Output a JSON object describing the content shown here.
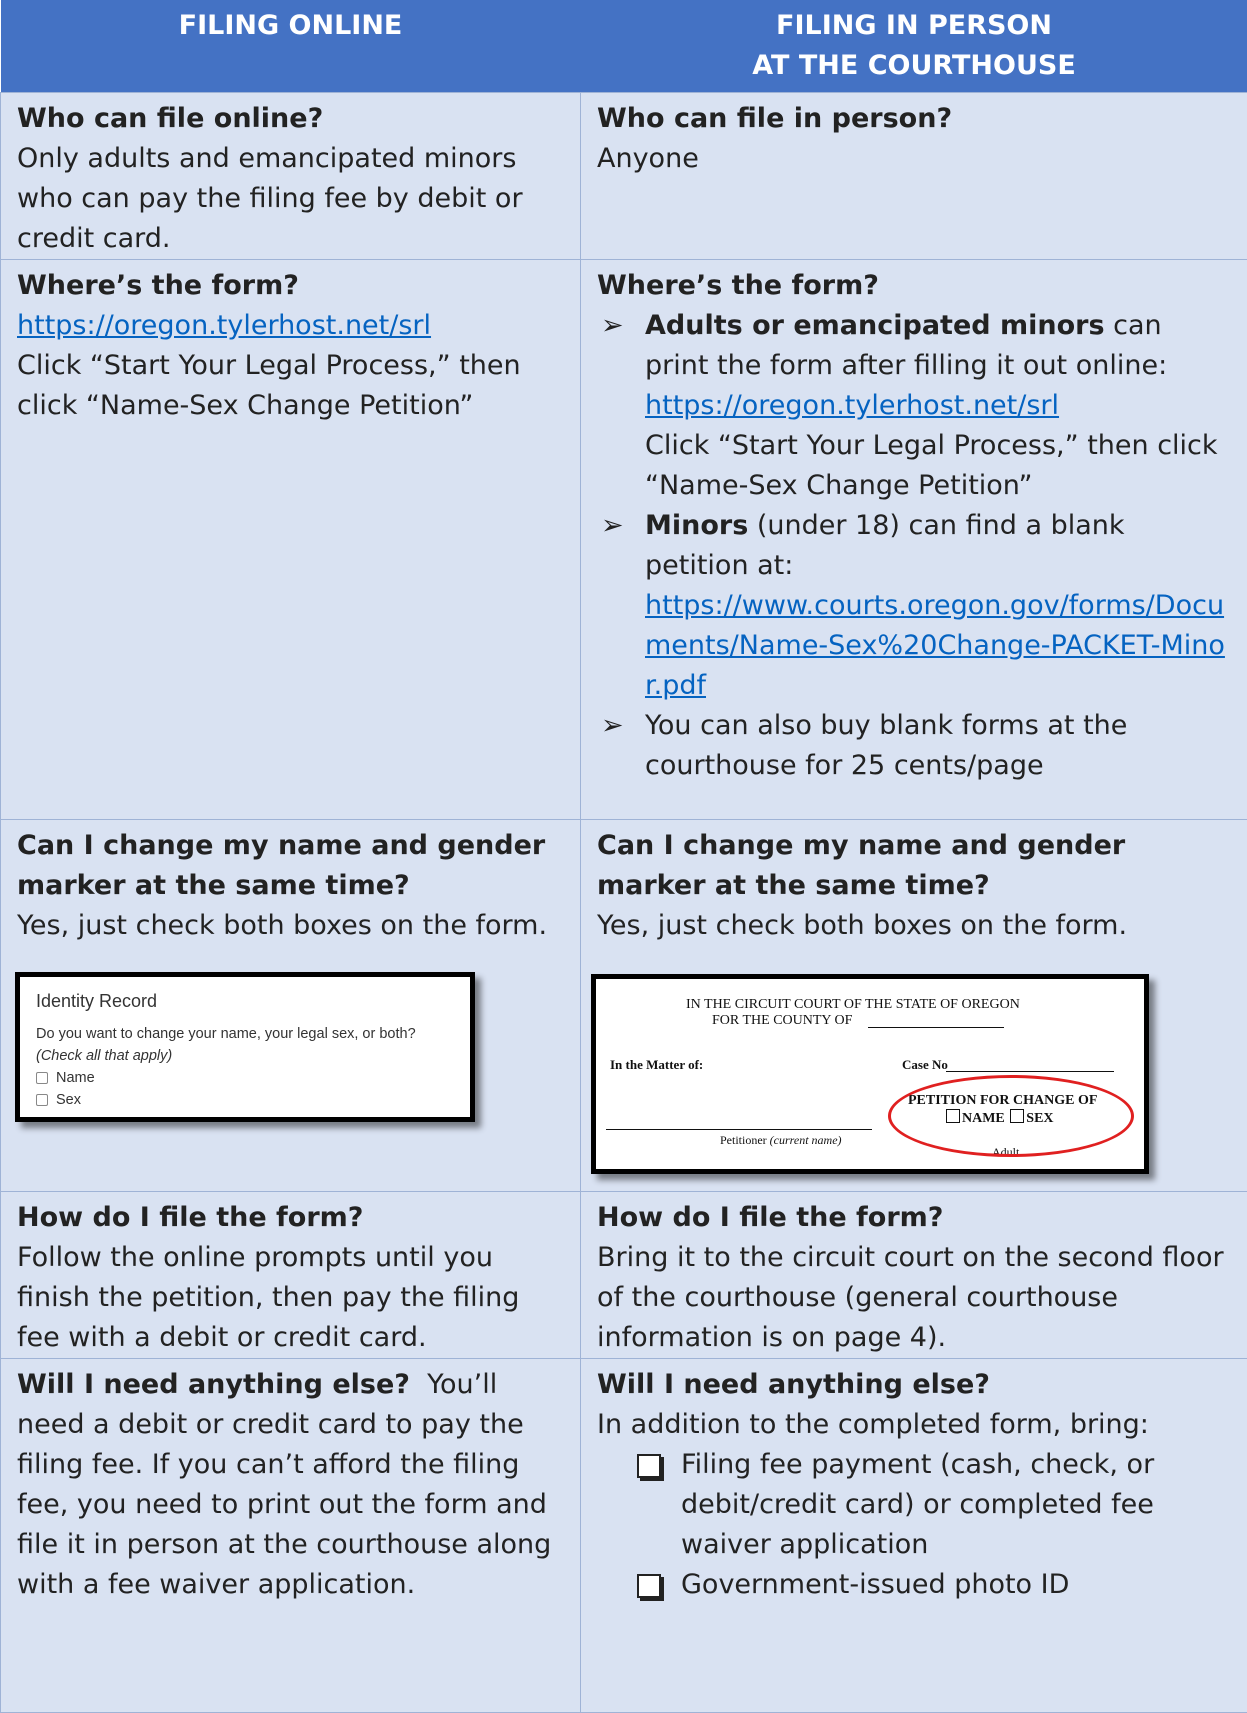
{
  "header": {
    "col_left": "FILING ONLINE",
    "col_right_line1": "FILING IN PERSON",
    "col_right_line2": "AT THE COURTHOUSE"
  },
  "row_who": {
    "left_q": "Who can file online?",
    "left_a": "Only adults and emancipated minors who can pay the filing fee by debit or credit card.",
    "right_q": "Who can file in person?",
    "right_a": "Anyone"
  },
  "row_form": {
    "left_q": "Where’s the form?",
    "left_link": "https://oregon.tylerhost.net/srl",
    "left_text": "Click “Start Your Legal Process,” then click “Name-Sex Change Petition”",
    "right_q": "Where’s the form?",
    "right_items": [
      {
        "bold": "Adults or emancipated minors",
        "text": " can print the form after filling it out online:",
        "link": "https://oregon.tylerhost.net/srl",
        "after": "Click “Start Your Legal Process,” then click “Name-Sex Change Petition”"
      },
      {
        "bold": "Minors",
        "text": " (under 18) can find a blank petition at:",
        "link": "https://www.courts.oregon.gov/forms/Documents/Name-Sex%20Change-PACKET-Minor.pdf",
        "after": ""
      },
      {
        "bold": "",
        "text": "You can also buy blank forms at the courthouse for 25 cents/page",
        "link": "",
        "after": ""
      }
    ]
  },
  "row_change": {
    "left_q": "Can I change my name and gender marker at the same time?",
    "left_a": "Yes, just check both boxes on the form.",
    "right_q": "Can I change my name and gender marker at the same time?",
    "right_a": "Yes, just check both boxes on the form.",
    "online_form": {
      "heading": "Identity Record",
      "question": "Do you want to change your name, your legal sex, or both?",
      "hint": "(Check all that apply)",
      "options": [
        "Name",
        "Sex"
      ]
    },
    "paper_form": {
      "court_line1": "IN THE CIRCUIT COURT OF THE STATE OF OREGON",
      "court_line2": "FOR THE COUNTY OF",
      "matter": "In the Matter of:",
      "case_no": "Case No",
      "petition_title": "PETITION FOR CHANGE OF",
      "opt_name": "NAME",
      "opt_sex": "SEX",
      "petitioner_label": "Petitioner",
      "petitioner_hint": "(current name)",
      "adult": "Adult"
    }
  },
  "row_file": {
    "left_q": "How do I file the form?",
    "left_a": "Follow the online prompts until you finish the petition, then pay the filing fee with a debit or credit card.",
    "right_q": "How do I file the form?",
    "right_a": "Bring it to the circuit court on the second floor of the courthouse (general courthouse information is on page 4)."
  },
  "row_else": {
    "left_q": "Will I need anything else?",
    "left_a": "You’ll need a debit or credit card to pay the filing fee. If you can’t afford the filing fee, you need to print out the form and file it in person at the courthouse along with a fee waiver application.",
    "right_q": "Will I need anything else?",
    "right_intro": "In addition to the completed form, bring:",
    "right_items": [
      "Filing fee payment (cash, check, or debit/credit card) or completed fee waiver application",
      "Government-issued photo ID"
    ]
  }
}
